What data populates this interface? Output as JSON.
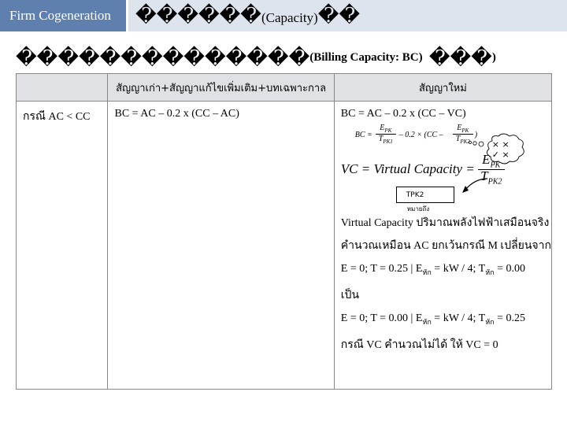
{
  "header": {
    "tag": "Firm Cogeneration",
    "title_glyphs": "������",
    "title_paren": "(Capacity)",
    "title_tail": "��"
  },
  "subtitle": {
    "glyphs": "��������������",
    "paren": "(Billing Capacity: BC)",
    "tail_glyphs": "���",
    "tail_paren": ")"
  },
  "table": {
    "headers": [
      "",
      "สัญญาเก่า+สัญญาแก้ไขเพิ่มเติม+บทเฉพาะกาล",
      "สัญญาใหม่"
    ],
    "row_label": "กรณี AC < CC",
    "old_formula": "BC = AC – 0.2 x (CC – AC)",
    "new": {
      "formula1": "BC = AC – 0.2 x (CC – VC)",
      "formula2_lhs": "BC =",
      "formula2_num": "E",
      "formula2_num_sub": "PK",
      "formula2_den": "T",
      "formula2_den_sub": "PK1",
      "formula2_mid": "– 0.2 × (CC –",
      "formula2_num2": "E",
      "formula2_num2_sub": "PK",
      "formula2_den2": "T",
      "formula2_den2_sub": "PK2",
      "formula2_end": ")",
      "vc_def": "VC = Virtual Capacity =",
      "vc_num": "E",
      "vc_num_sub": "PK",
      "vc_den": "T",
      "vc_den_sub": "PK2",
      "box_label": "TPK2",
      "box_note": "หมายถึง",
      "lines": [
        "Virtual Capacity ปริมาณพลังไฟฟ้าเสมือนจริง",
        "คำนวณเหมือน AC ยกเว้นกรณี  M เปลี่ยนจาก",
        "E = 0; T = 0.25  |  E",
        "เป็น",
        "E = 0; T = 0.00  |  E",
        "",
        "กรณี VC คำนวณไม่ได้ ให้ VC = 0"
      ],
      "line3_sub": "หัก",
      "line3_rest": "= kW / 4; T",
      "line3_sub2": "หัก",
      "line3_end": "= 0.00",
      "line5_sub": "หัก",
      "line5_rest": "= kW / 4; T",
      "line5_sub2": "หัก",
      "line5_end": "= 0.25",
      "cloud_marks": "× ×\n✓ ×"
    }
  }
}
